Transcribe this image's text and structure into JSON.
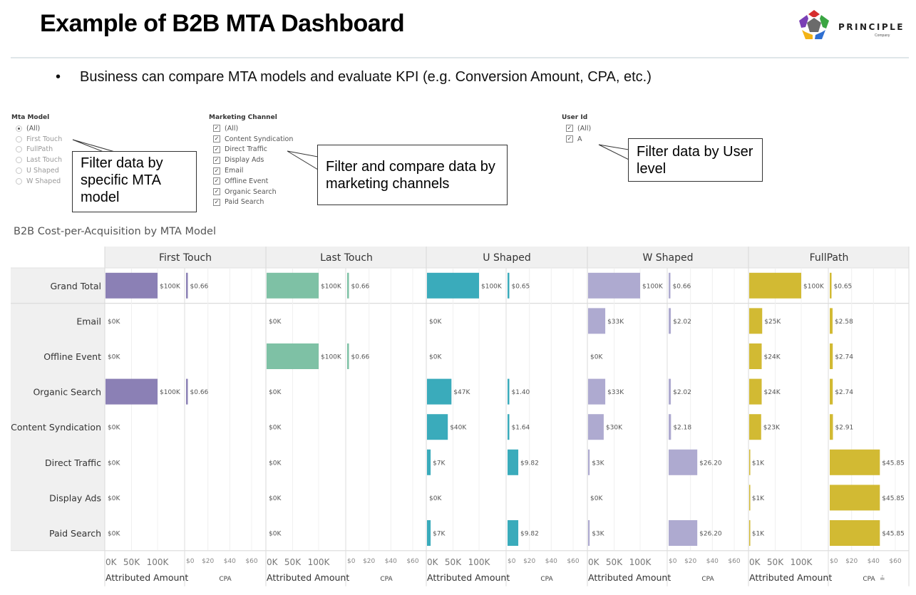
{
  "slide": {
    "title": "Example of B2B MTA Dashboard",
    "bullet": "Business can compare MTA models and evaluate KPI (e.g. Conversion Amount, CPA, etc.)",
    "bullet_marker": "•"
  },
  "logo": {
    "name": "PRINCIPLE",
    "subtitle": "Company",
    "icon": "pentagon-logo-icon",
    "colors": [
      "#d62e2e",
      "#3aa542",
      "#2f6fd1",
      "#f3b316",
      "#7a3fb5"
    ]
  },
  "filters": {
    "mta_model": {
      "title": "Mta Model",
      "type": "radio",
      "options": [
        {
          "label": "(All)",
          "selected": true
        },
        {
          "label": "First Touch",
          "selected": false
        },
        {
          "label": "FullPath",
          "selected": false
        },
        {
          "label": "Last Touch",
          "selected": false
        },
        {
          "label": "U Shaped",
          "selected": false
        },
        {
          "label": "W Shaped",
          "selected": false
        }
      ]
    },
    "marketing_channel": {
      "title": "Marketing Channel",
      "type": "checkbox",
      "options": [
        {
          "label": "(All)",
          "checked": true
        },
        {
          "label": "Content Syndication",
          "checked": true
        },
        {
          "label": "Direct Traffic",
          "checked": true
        },
        {
          "label": "Display Ads",
          "checked": true
        },
        {
          "label": "Email",
          "checked": true
        },
        {
          "label": "Offline Event",
          "checked": true
        },
        {
          "label": "Organic Search",
          "checked": true
        },
        {
          "label": "Paid Search",
          "checked": true
        }
      ]
    },
    "user_id": {
      "title": "User Id",
      "type": "checkbox",
      "options": [
        {
          "label": "(All)",
          "checked": true
        },
        {
          "label": "A",
          "checked": true
        }
      ]
    }
  },
  "callouts": {
    "mta": "Filter data by specific MTA model",
    "channel": "Filter and compare data by marketing channels",
    "user": "Filter data by User level"
  },
  "chart_data": {
    "type": "bar",
    "title": "B2B Cost-per-Acquisition by MTA Model",
    "orientation": "horizontal",
    "categories": [
      "Grand Total",
      "Email",
      "Offline Event",
      "Organic Search",
      "Content Syndication",
      "Direct Traffic",
      "Display Ads",
      "Paid Search"
    ],
    "measures": [
      {
        "name": "Attributed Amount",
        "unit": "K$",
        "ticks": [
          "0K",
          "50K",
          "100K"
        ],
        "tick_values": [
          0,
          50,
          100
        ],
        "range": [
          0,
          150
        ]
      },
      {
        "name": "CPA",
        "unit": "$",
        "ticks": [
          "$0",
          "$20",
          "$40",
          "$60"
        ],
        "tick_values": [
          0,
          20,
          40,
          60
        ],
        "range": [
          0,
          70
        ],
        "sort_icon": "sort-descending-icon"
      }
    ],
    "series": [
      {
        "name": "First Touch",
        "color": "#8b80b5",
        "amount": [
          100,
          0,
          0,
          100,
          0,
          0,
          0,
          0
        ],
        "amount_labels": [
          "$100K",
          "$0K",
          "$0K",
          "$100K",
          "$0K",
          "$0K",
          "$0K",
          "$0K"
        ],
        "cpa": [
          0.66,
          null,
          null,
          0.66,
          null,
          null,
          null,
          null
        ],
        "cpa_labels": [
          "$0.66",
          "",
          "",
          "$0.66",
          "",
          "",
          "",
          ""
        ]
      },
      {
        "name": "Last Touch",
        "color": "#7ec1a5",
        "amount": [
          100,
          0,
          100,
          0,
          0,
          0,
          0,
          0
        ],
        "amount_labels": [
          "$100K",
          "$0K",
          "$100K",
          "$0K",
          "$0K",
          "$0K",
          "$0K",
          "$0K"
        ],
        "cpa": [
          0.66,
          null,
          0.66,
          null,
          null,
          null,
          null,
          null
        ],
        "cpa_labels": [
          "$0.66",
          "",
          "$0.66",
          "",
          "",
          "",
          "",
          ""
        ]
      },
      {
        "name": "U Shaped",
        "color": "#3aabbb",
        "amount": [
          100,
          0,
          0,
          47,
          40,
          7,
          0,
          7
        ],
        "amount_labels": [
          "$100K",
          "$0K",
          "$0K",
          "$47K",
          "$40K",
          "$7K",
          "$0K",
          "$7K"
        ],
        "cpa": [
          0.65,
          null,
          null,
          1.4,
          1.64,
          9.82,
          null,
          9.82
        ],
        "cpa_labels": [
          "$0.65",
          "",
          "",
          "$1.40",
          "$1.64",
          "$9.82",
          "",
          "$9.82"
        ]
      },
      {
        "name": "W Shaped",
        "color": "#aeaad0",
        "amount": [
          100,
          33,
          0,
          33,
          30,
          3,
          0,
          3
        ],
        "amount_labels": [
          "$100K",
          "$33K",
          "$0K",
          "$33K",
          "$30K",
          "$3K",
          "$0K",
          "$3K"
        ],
        "cpa": [
          0.66,
          2.02,
          null,
          2.02,
          2.18,
          26.2,
          null,
          26.2
        ],
        "cpa_labels": [
          "$0.66",
          "$2.02",
          "",
          "$2.02",
          "$2.18",
          "$26.20",
          "",
          "$26.20"
        ]
      },
      {
        "name": "FullPath",
        "color": "#d2ba33",
        "amount": [
          100,
          25,
          24,
          24,
          23,
          1,
          1,
          1
        ],
        "amount_labels": [
          "$100K",
          "$25K",
          "$24K",
          "$24K",
          "$23K",
          "$1K",
          "$1K",
          "$1K"
        ],
        "cpa": [
          0.65,
          2.58,
          2.74,
          2.74,
          2.91,
          45.85,
          45.85,
          45.85
        ],
        "cpa_labels": [
          "$0.65",
          "$2.58",
          "$2.74",
          "$2.74",
          "$2.91",
          "$45.85",
          "$45.85",
          "$45.85"
        ]
      }
    ],
    "grid": true,
    "legend": "none"
  }
}
